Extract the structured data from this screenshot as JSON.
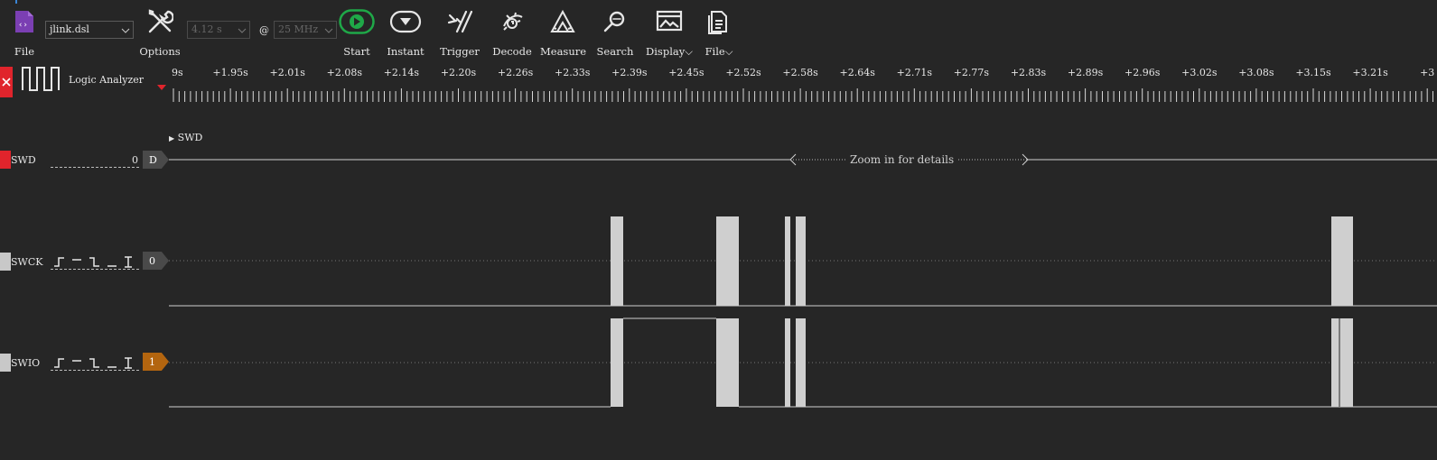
{
  "toolbar": {
    "file_label": "File",
    "session_file": "jlink.dsl",
    "options_label": "Options",
    "duration_value": "4.12 s",
    "at_sign": "@",
    "rate_value": "25 MHz",
    "start_label": "Start",
    "instant_label": "Instant",
    "trigger_label": "Trigger",
    "decode_label": "Decode",
    "measure_label": "Measure",
    "search_label": "Search",
    "display_label": "Display",
    "file_menu_label": "File"
  },
  "ruler": {
    "device_label": "Logic Analyzer",
    "ticks": [
      "9s",
      "+1.95s",
      "+2.01s",
      "+2.08s",
      "+2.14s",
      "+2.20s",
      "+2.26s",
      "+2.33s",
      "+2.39s",
      "+2.45s",
      "+2.52s",
      "+2.58s",
      "+2.64s",
      "+2.71s",
      "+2.77s",
      "+2.83s",
      "+2.89s",
      "+2.96s",
      "+3.02s",
      "+3.08s",
      "+3.15s",
      "+3.21s",
      "+3"
    ]
  },
  "decoder": {
    "group_label": "SWD",
    "channel_label": "SWD",
    "value": "0",
    "badge": "D",
    "zoom_hint": "Zoom in for details"
  },
  "channels": [
    {
      "name": "SWCK",
      "badge": "0",
      "color": "#c8c8c8"
    },
    {
      "name": "SWIO",
      "badge": "1",
      "color": "#c8c8c8"
    }
  ],
  "colors": {
    "background": "#262626",
    "decoder_swatch": "#e0242c",
    "swio_badge": "#b3650f",
    "default_badge": "#4a4a4a",
    "start_green": "#1fa848",
    "file_purple": "#7b3fb3"
  }
}
